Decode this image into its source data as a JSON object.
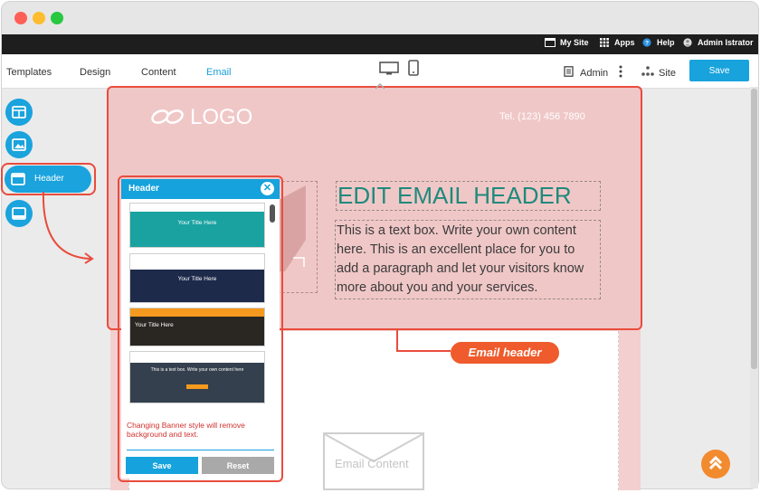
{
  "adminbar": {
    "my_site": "My Site",
    "apps": "Apps",
    "help": "Help",
    "user": "Admin Istrator"
  },
  "toolbar": {
    "tabs": [
      "Templates",
      "Design",
      "Content",
      "Email"
    ],
    "active_tab": "Email",
    "admin_label": "Admin",
    "site_label": "Site",
    "save_label": "Save"
  },
  "sidebar": {
    "items": [
      {
        "icon": "layout-grid-icon"
      },
      {
        "icon": "image-icon"
      },
      {
        "icon": "header-icon",
        "label": "Header"
      },
      {
        "icon": "footer-icon"
      }
    ]
  },
  "email_header": {
    "logo_text": "LOGO",
    "tel": "Tel. (123) 456 7890",
    "title": "EDIT EMAIL HEADER",
    "body": "This is a text box. Write your own content here. This is an excellent place for you to add a paragraph and let your visitors know more about you and your services."
  },
  "header_panel": {
    "title": "Header",
    "thumb_titles": [
      "Your Title Here",
      "Your Title Here",
      "Your Title Here",
      "This is a text box. Write your own content here"
    ],
    "notice": "Changing Banner style will remove background and text.",
    "save_label": "Save",
    "reset_label": "Reset"
  },
  "email_content_label": "Email Content",
  "annotation": "Email header",
  "colors": {
    "accent": "#19a3dd",
    "highlight": "#e94c3d",
    "title_teal": "#1f8a7c",
    "annotation_orange": "#ef5b2c"
  }
}
